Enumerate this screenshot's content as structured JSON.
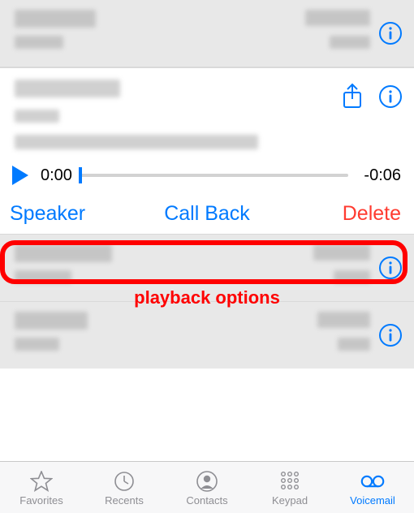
{
  "colors": {
    "accent": "#007aff",
    "danger": "#ff3b30",
    "inactive": "#8e8e93"
  },
  "list": {
    "above": [
      {
        "id": 0
      }
    ],
    "below": [
      {
        "id": 1
      },
      {
        "id": 2
      }
    ]
  },
  "expanded": {
    "player": {
      "elapsed": "0:00",
      "remaining": "-0:06",
      "progress_percent": 0
    },
    "actions": {
      "speaker": "Speaker",
      "call_back": "Call Back",
      "delete": "Delete"
    }
  },
  "annotation": {
    "label": "playback options"
  },
  "tabs": [
    {
      "key": "favorites",
      "label": "Favorites",
      "active": false
    },
    {
      "key": "recents",
      "label": "Recents",
      "active": false
    },
    {
      "key": "contacts",
      "label": "Contacts",
      "active": false
    },
    {
      "key": "keypad",
      "label": "Keypad",
      "active": false
    },
    {
      "key": "voicemail",
      "label": "Voicemail",
      "active": true
    }
  ]
}
